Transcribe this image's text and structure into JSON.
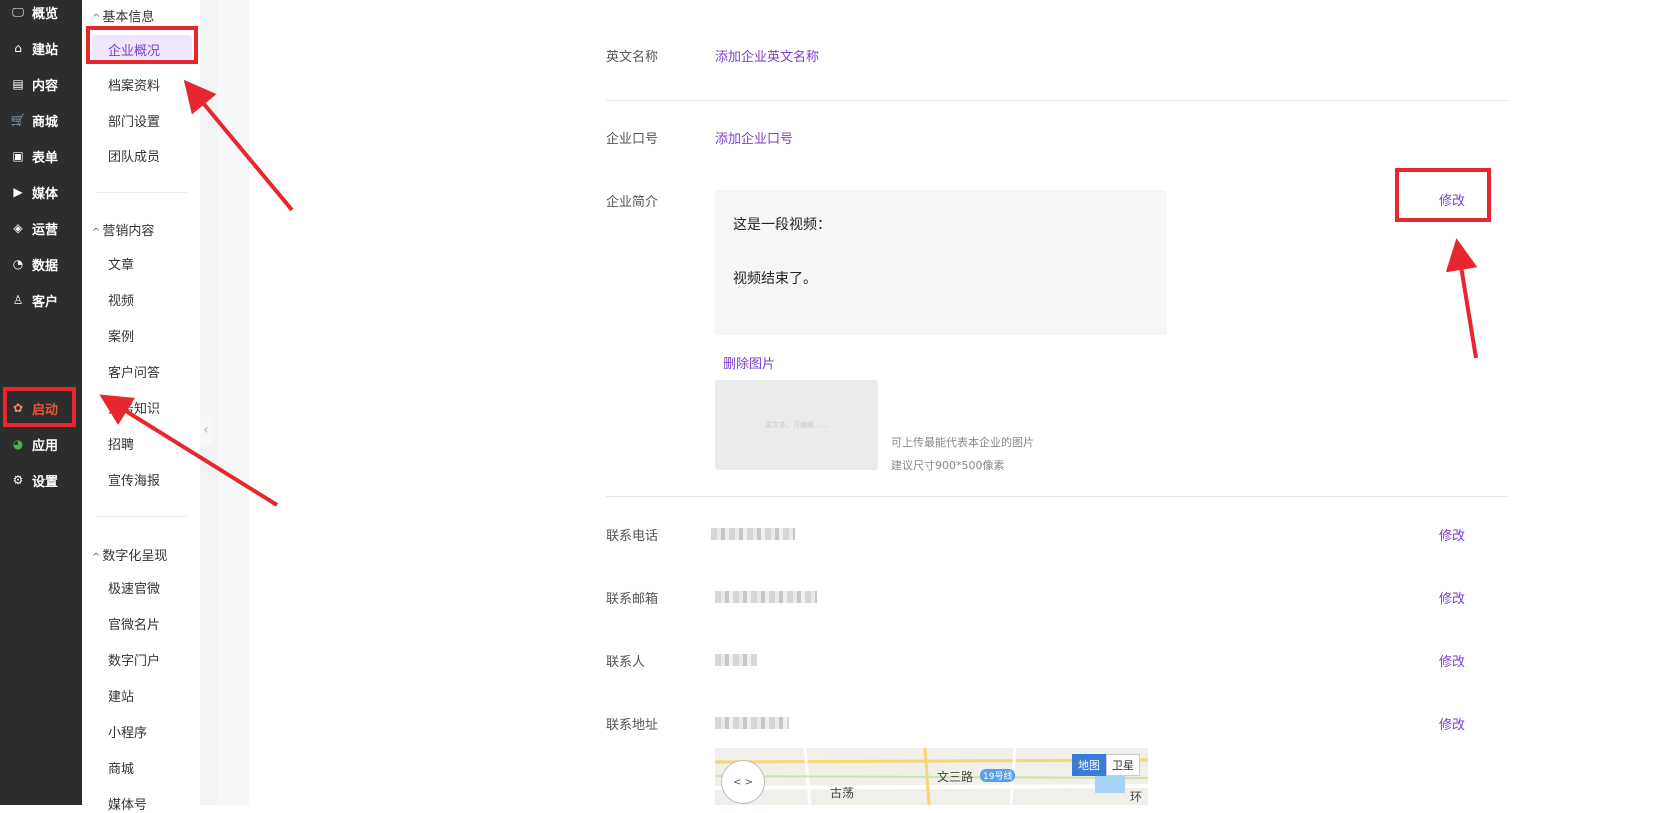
{
  "sidebar": {
    "items": [
      {
        "label": "概览",
        "icon": "overview-icon",
        "glyph": "🖵"
      },
      {
        "label": "建站",
        "icon": "home-icon",
        "glyph": "⌂"
      },
      {
        "label": "内容",
        "icon": "document-icon",
        "glyph": "▤"
      },
      {
        "label": "商城",
        "icon": "cart-icon",
        "glyph": "🛒"
      },
      {
        "label": "表单",
        "icon": "form-icon",
        "glyph": "▣"
      },
      {
        "label": "媒体",
        "icon": "video-icon",
        "glyph": "▶"
      },
      {
        "label": "运营",
        "icon": "tag-icon",
        "glyph": "◈"
      },
      {
        "label": "数据",
        "icon": "pie-chart-icon",
        "glyph": "◔"
      },
      {
        "label": "客户",
        "icon": "user-icon",
        "glyph": "♙"
      }
    ],
    "bottom_items": [
      {
        "label": "启动",
        "icon": "launch-icon",
        "glyph": "✿"
      },
      {
        "label": "应用",
        "icon": "apps-icon",
        "glyph": "◕"
      },
      {
        "label": "设置",
        "icon": "gear-icon",
        "glyph": "⚙"
      }
    ]
  },
  "subnav": {
    "groups": [
      {
        "title": "基本信息",
        "items": [
          "企业概况",
          "档案资料",
          "部门设置",
          "团队成员"
        ]
      },
      {
        "title": "营销内容",
        "items": [
          "文章",
          "视频",
          "案例",
          "客户问答",
          "业务知识",
          "招聘",
          "宣传海报"
        ]
      },
      {
        "title": "数字化呈现",
        "items": [
          "极速官微",
          "官微名片",
          "数字门户",
          "建站",
          "小程序",
          "商城",
          "媒体号"
        ]
      }
    ],
    "active": "企业概况",
    "collapse_glyph": "‹"
  },
  "main": {
    "english_name": {
      "label": "英文名称",
      "link": "添加企业英文名称"
    },
    "slogan": {
      "label": "企业口号",
      "link": "添加企业口号"
    },
    "intro": {
      "label": "企业简介",
      "edit": "修改",
      "lines": [
        "这是一段视频：",
        "视频结束了。"
      ],
      "delete_image": "删除图片",
      "placeholder_text": "富文本，可编辑……",
      "hint1": "可上传最能代表本企业的图片",
      "hint2": "建议尺寸900*500像素"
    },
    "phone": {
      "label": "联系电话",
      "edit": "修改"
    },
    "email": {
      "label": "联系邮箱",
      "edit": "修改"
    },
    "contact": {
      "label": "联系人",
      "edit": "修改"
    },
    "address": {
      "label": "联系地址",
      "edit": "修改"
    },
    "map": {
      "tab_map": "地图",
      "tab_sat": "卫星",
      "road": "文三路",
      "metro": "19号线",
      "area": "古荡",
      "edge": "环"
    }
  },
  "colors": {
    "accent": "#7a3fd0",
    "annotation": "#e8262e",
    "sidebar": "#2d2d2d"
  }
}
